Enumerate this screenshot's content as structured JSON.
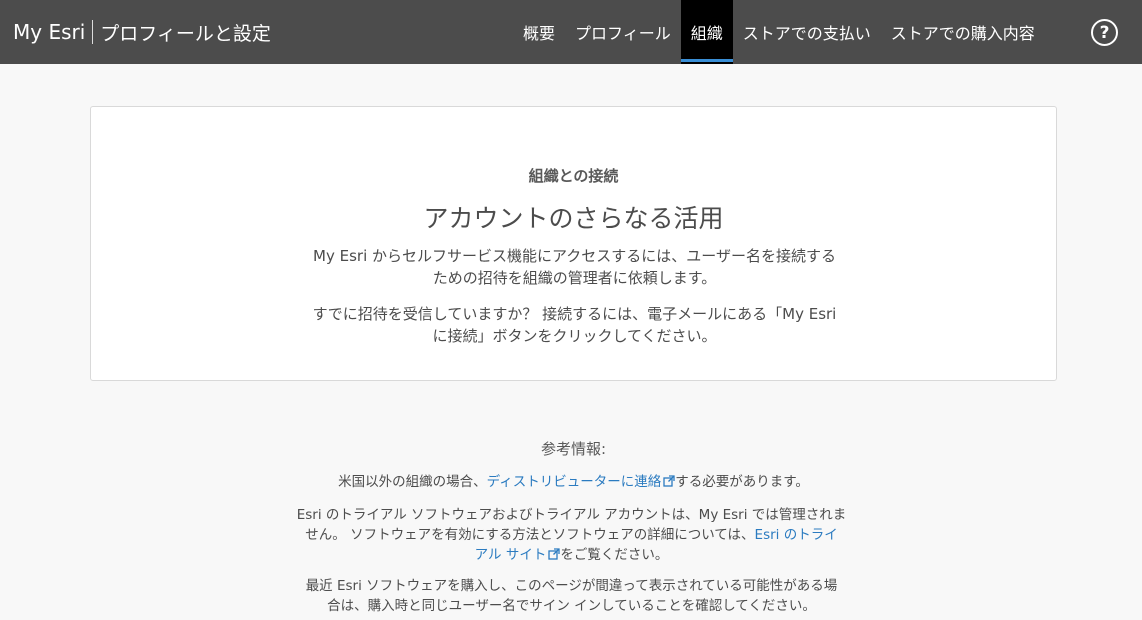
{
  "header": {
    "brand": "My Esri",
    "subtitle": "プロフィールと設定",
    "nav": [
      {
        "label": "概要",
        "active": false
      },
      {
        "label": "プロフィール",
        "active": false
      },
      {
        "label": "組織",
        "active": true
      },
      {
        "label": "ストアでの支払い",
        "active": false
      },
      {
        "label": "ストアでの購入内容",
        "active": false
      }
    ],
    "help_label": "?"
  },
  "card": {
    "eyebrow": "組織との接続",
    "title": "アカウントのさらなる活用",
    "p1_line1": "My Esri からセルフサービス機能にアクセスするには、ユーザー名を接続する",
    "p1_line2": "ための招待を組織の管理者に依頼します。",
    "p2_line1": "すでに招待を受信していますか？ 接続するには、電子メールにある「My Esri",
    "p2_line2": "に接続」ボタンをクリックしてください。"
  },
  "reference": {
    "heading": "参考情報:",
    "p1_before": "米国以外の組織の場合、",
    "p1_link": "ディストリビューターに連絡",
    "p1_after": "する必要があります。",
    "p2_line1": "Esri のトライアル ソフトウェアおよびトライアル アカウントは、My Esri では管理されま",
    "p2_line2_before": "せん。 ソフトウェアを有効にする方法とソフトウェアの詳細については、",
    "p2_link_part1": "Esri のトライ",
    "p2_link_part2": "アル サイト",
    "p2_after": "をご覧ください。",
    "p3_line1": "最近 Esri ソフトウェアを購入し、このページが間違って表示されている可能性がある場",
    "p3_line2": "合は、購入時と同じユーザー名でサイン インしていることを確認してください。"
  },
  "colors": {
    "header_bg": "#4c4c4c",
    "active_tab_bg": "#000000",
    "active_tab_underline": "#3a8fd6",
    "link": "#2b7bc0",
    "page_bg": "#f8f8f8"
  }
}
